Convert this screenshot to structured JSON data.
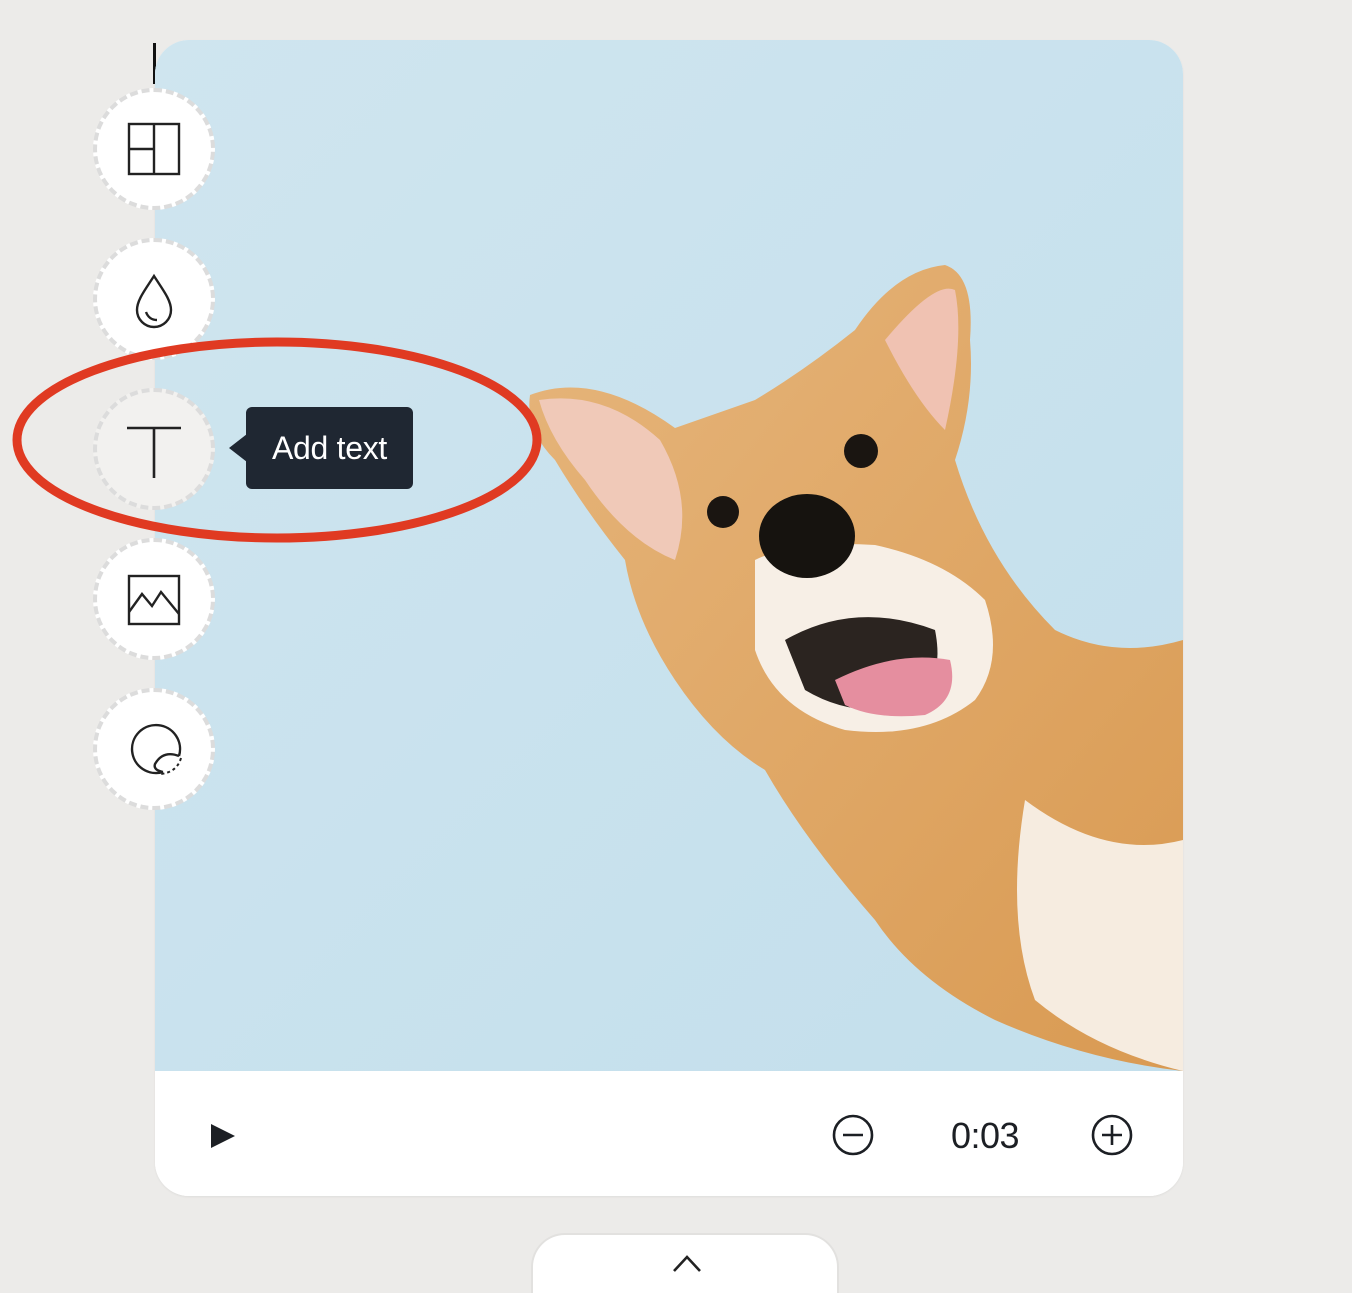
{
  "toolbar": {
    "tools": [
      {
        "name": "layout",
        "icon": "layout-icon"
      },
      {
        "name": "color",
        "icon": "drop-icon"
      },
      {
        "name": "text",
        "icon": "text-icon"
      },
      {
        "name": "media",
        "icon": "image-icon"
      },
      {
        "name": "sticker",
        "icon": "sticker-icon"
      }
    ],
    "active_tool": "text"
  },
  "tooltip": {
    "label": "Add text"
  },
  "canvas": {
    "background_color": "#cbe3ee",
    "image": "shiba-inu-dog-photo"
  },
  "player": {
    "play_icon": "play-icon",
    "zoom_out_icon": "minus-circle-icon",
    "zoom_in_icon": "plus-circle-icon",
    "duration": "0:03"
  },
  "expand_tab": {
    "icon": "chevron-up-icon"
  },
  "colors": {
    "page_background": "#ecebe9",
    "tooltip_background": "#1f2732",
    "highlight_ring": "#e03a22"
  }
}
